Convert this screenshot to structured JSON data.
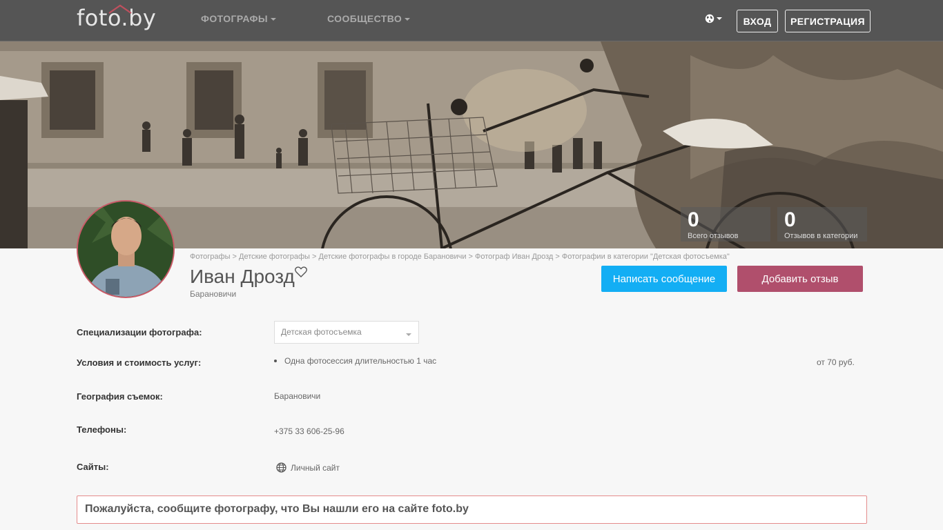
{
  "navbar": {
    "logo": "foto.by",
    "menu": [
      {
        "label": "ФОТОГРАФЫ"
      },
      {
        "label": "СООБЩЕСТВО"
      }
    ],
    "login_label": "ВХОД",
    "register_label": "РЕГИСТРАЦИЯ",
    "language_icon": "globe-icon"
  },
  "stats": [
    {
      "value": "0",
      "label": "Всего отзывов"
    },
    {
      "value": "0",
      "label": "Отзывов в категории"
    }
  ],
  "breadcrumb": [
    "Фотографы",
    "Детские фотографы",
    "Детские фотографы в городе Барановичи",
    "Фотограф Иван Дрозд",
    "Фотографии в категории \"Детская фотосъемка\""
  ],
  "breadcrumb_separator": ">",
  "profile": {
    "name": "Иван Дрозд",
    "city": "Барановичи",
    "favorite_icon": "heart-icon"
  },
  "actions": {
    "message_label": "Написать сообщение",
    "review_label": "Добавить отзыв"
  },
  "info": {
    "specializations": {
      "label": "Специализации фотографа:",
      "selected": "Детская фотосъемка"
    },
    "services": {
      "label": "Условия и стоимость услуг:",
      "items": [
        {
          "name": "Одна фотосессия длительностью 1 час",
          "price": "от 70 руб."
        }
      ]
    },
    "geography": {
      "label": "География съемок:",
      "value": "Барановичи"
    },
    "phones": {
      "label": "Телефоны:",
      "value": "+375 33 606-25-96"
    },
    "sites": {
      "label": "Сайты:",
      "link_label": "Личный сайт"
    }
  },
  "notice": "Пожалуйста, сообщите фотографу, что Вы нашли его на сайте foto.by",
  "colors": {
    "navbar_bg": "#555555",
    "message_button": "#13aef4",
    "review_button": "#b04f6c",
    "notice_border": "#e48b8b",
    "avatar_border": "#c95a68"
  }
}
